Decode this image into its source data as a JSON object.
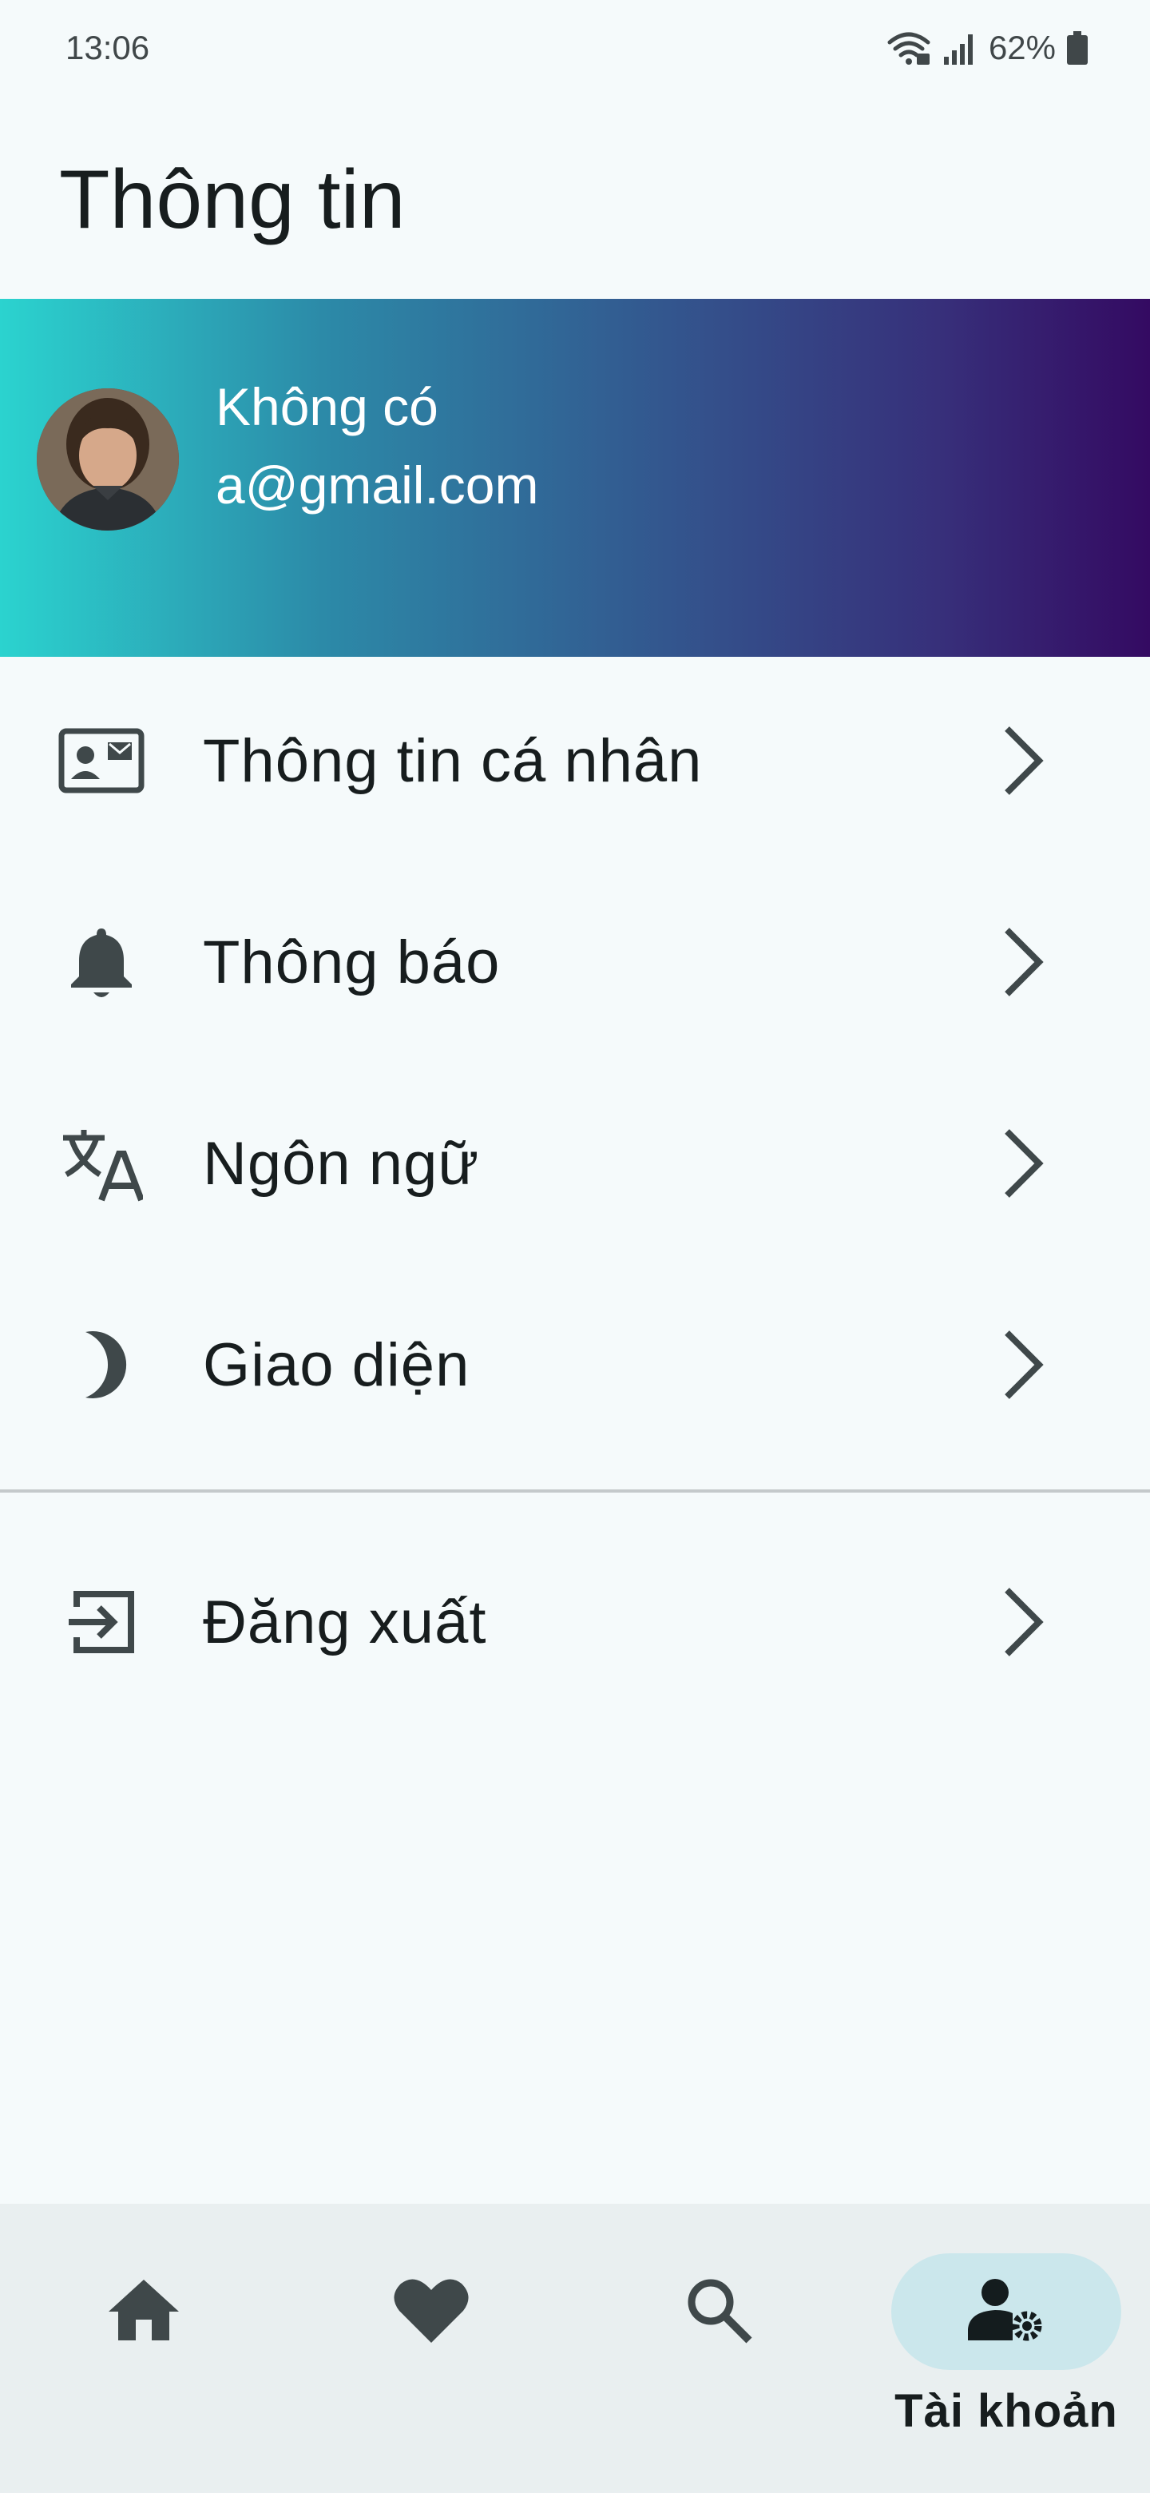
{
  "status_bar": {
    "time": "13:06",
    "battery": "62%"
  },
  "page": {
    "title": "Thông tin"
  },
  "profile": {
    "name": "Không có",
    "email": "a@gmail.com"
  },
  "menu": {
    "items": [
      {
        "label": "Thông tin cá nhân",
        "icon": "contact-card-icon"
      },
      {
        "label": "Thông báo",
        "icon": "bell-icon"
      },
      {
        "label": "Ngôn ngữ",
        "icon": "translate-icon"
      },
      {
        "label": "Giao diện",
        "icon": "dark-mode-moon-icon"
      }
    ],
    "logout": {
      "label": "Đăng xuất",
      "icon": "logout-icon"
    }
  },
  "bottom_nav": {
    "items": [
      {
        "icon": "home-icon",
        "label": ""
      },
      {
        "icon": "heart-icon",
        "label": ""
      },
      {
        "icon": "search-icon",
        "label": ""
      },
      {
        "icon": "account-settings-icon",
        "label": "Tài khoản",
        "active": true
      }
    ]
  },
  "colors": {
    "background": "#f5fafb",
    "banner_gradient_start": "#2bd3cf",
    "banner_gradient_end": "#340a62",
    "icon": "#3f484a",
    "nav_active_pill": "#cbe7ec",
    "nav_background": "#e9eff0"
  }
}
